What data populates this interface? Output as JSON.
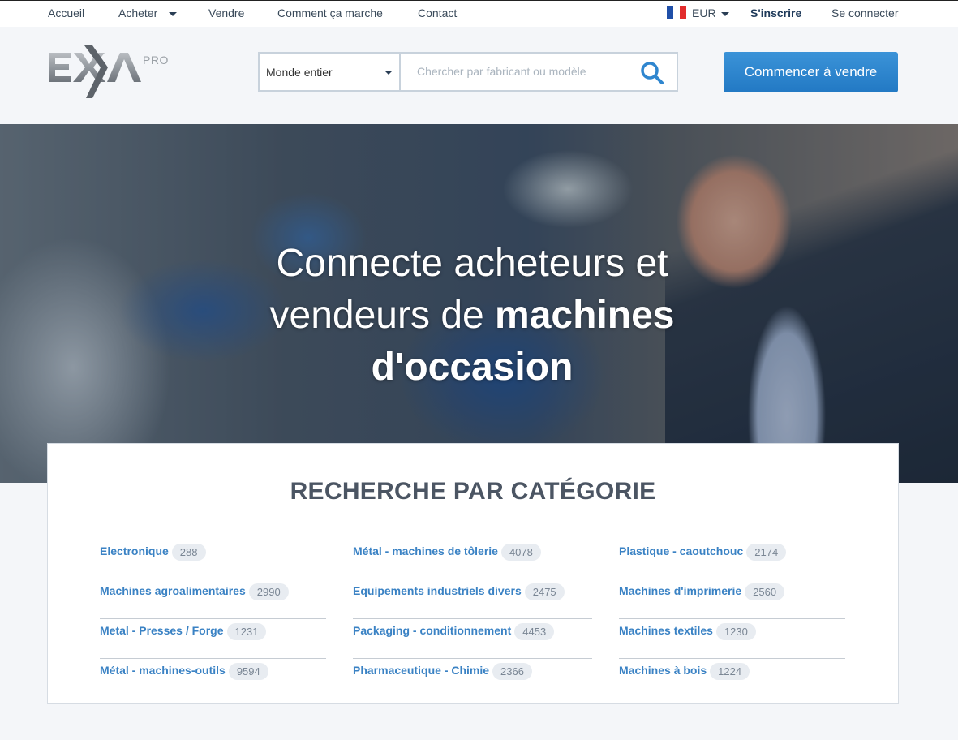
{
  "nav": {
    "accueil": "Accueil",
    "acheter": "Acheter",
    "vendre": "Vendre",
    "comment": "Comment ça marche",
    "contact": "Contact",
    "currency": "EUR",
    "signup": "S'inscrire",
    "login": "Se connecter"
  },
  "logo": {
    "text": "EXA",
    "sup": "PRO"
  },
  "search": {
    "region": "Monde entier",
    "placeholder": "Chercher par fabricant ou modèle"
  },
  "cta": "Commencer à vendre",
  "hero": {
    "line1": "Connecte acheteurs et",
    "line2a": "vendeurs de ",
    "line2b": "machines",
    "line3": "d'occasion"
  },
  "categories": {
    "title": "RECHERCHE PAR CATÉGORIE",
    "columns": [
      [
        {
          "label": "Electronique",
          "count": "288"
        },
        {
          "label": "Machines agroalimentaires",
          "count": "2990"
        },
        {
          "label": "Metal - Presses / Forge",
          "count": "1231"
        },
        {
          "label": "Métal - machines-outils",
          "count": "9594"
        }
      ],
      [
        {
          "label": "Métal - machines de tôlerie",
          "count": "4078"
        },
        {
          "label": "Equipements industriels divers",
          "count": "2475"
        },
        {
          "label": "Packaging - conditionnement",
          "count": "4453"
        },
        {
          "label": "Pharmaceutique - Chimie",
          "count": "2366"
        }
      ],
      [
        {
          "label": "Plastique - caoutchouc",
          "count": "2174"
        },
        {
          "label": "Machines d'imprimerie",
          "count": "2560"
        },
        {
          "label": "Machines textiles",
          "count": "1230"
        },
        {
          "label": "Machines à bois",
          "count": "1224"
        }
      ]
    ]
  },
  "colors": {
    "accent": "#2f86cf",
    "link": "#3a82c4",
    "title": "#4b5563"
  }
}
